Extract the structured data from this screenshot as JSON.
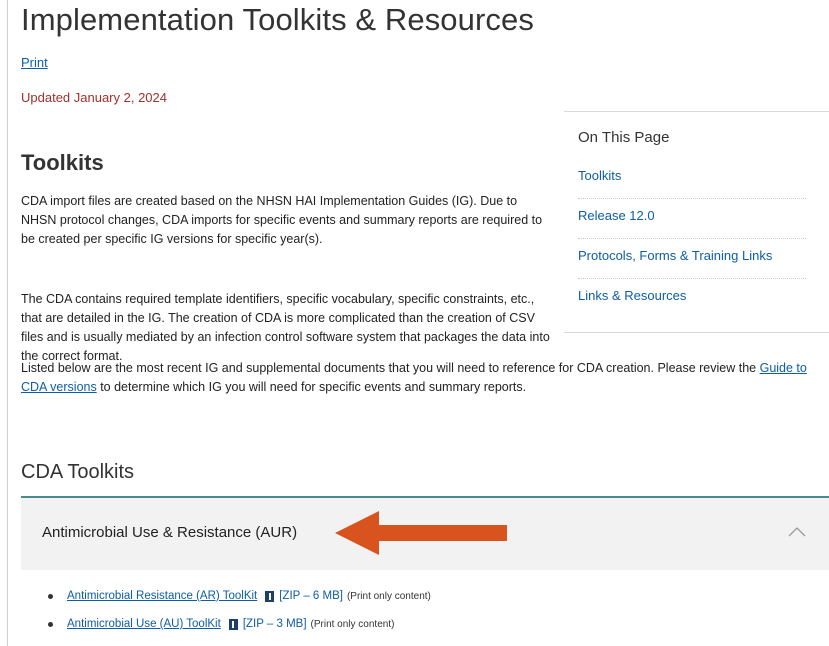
{
  "page": {
    "title": "Implementation Toolkits & Resources",
    "print_label": "Print",
    "updated": "Updated January 2, 2024"
  },
  "sidebar": {
    "title": "On This Page",
    "items": [
      {
        "label": "Toolkits"
      },
      {
        "label": "Release 12.0"
      },
      {
        "label": "Protocols, Forms & Training Links"
      },
      {
        "label": "Links & Resources"
      }
    ]
  },
  "toolkits": {
    "heading": "Toolkits",
    "para1": "CDA import files are created based on the NHSN HAI Implementation Guides (IG).  Due to NHSN protocol changes, CDA imports for specific events and summary reports are required to be created per specific IG versions for specific year(s).",
    "para2": "The CDA contains required template identifiers, specific vocabulary, specific constraints, etc., that are detailed in the IG. The creation of CDA is more complicated than the creation of CSV files and is usually mediated by an infection control software system that packages the data into the correct format.",
    "para3_before": "Listed below are the most recent IG and supplemental documents that you will need to reference for CDA creation. Please review the ",
    "para3_link": "Guide to CDA versions",
    "para3_after": " to determine which IG you will need for specific events and summary reports."
  },
  "cda_toolkits": {
    "heading": "CDA Toolkits",
    "accordion": {
      "title": "Antimicrobial Use & Resistance (AUR)",
      "arrow_color": "#d9531e",
      "accent_color": "#4a8c8c"
    },
    "files": [
      {
        "label": "Antimicrobial Resistance (AR) ToolKit ",
        "zip": "[ZIP – 6 MB]",
        "note": "(Print only content)"
      },
      {
        "label": "Antimicrobial Use (AU) ToolKit ",
        "zip": "[ZIP – 3 MB]",
        "note": "(Print only content)"
      }
    ]
  }
}
